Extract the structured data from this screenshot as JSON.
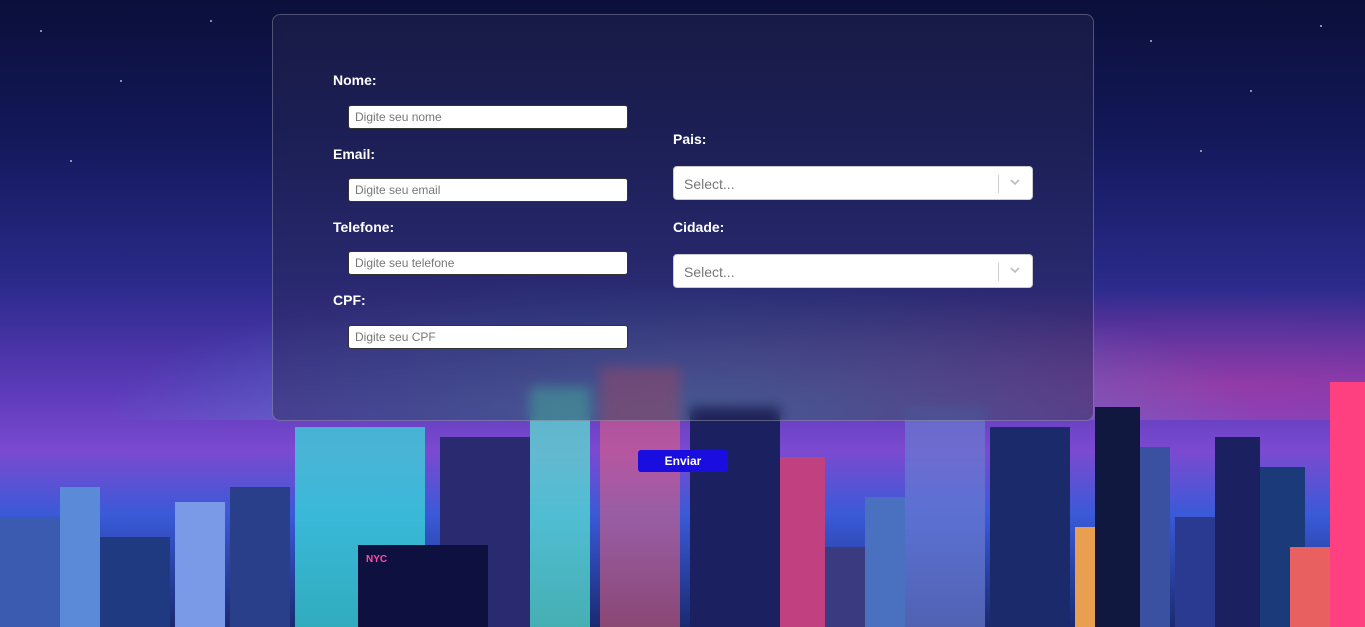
{
  "form": {
    "nome": {
      "label": "Nome:",
      "placeholder": "Digite seu nome",
      "value": ""
    },
    "email": {
      "label": "Email:",
      "placeholder": "Digite seu email",
      "value": ""
    },
    "telefone": {
      "label": "Telefone:",
      "placeholder": "Digite seu telefone",
      "value": ""
    },
    "cpf": {
      "label": "CPF:",
      "placeholder": "Digite seu CPF",
      "value": ""
    },
    "pais": {
      "label": "Pais:",
      "selected": "Select..."
    },
    "cidade": {
      "label": "Cidade:",
      "selected": "Select..."
    }
  },
  "submit_label": "Enviar",
  "background": {
    "sign": "NYC"
  },
  "colors": {
    "button": "#1a0de0"
  }
}
